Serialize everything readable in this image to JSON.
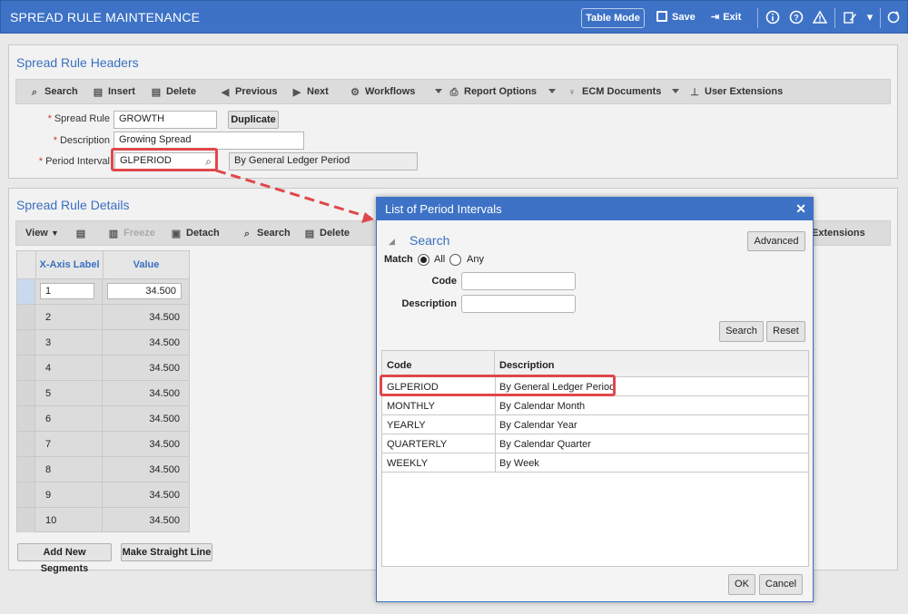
{
  "window": {
    "title": "SPREAD RULE MAINTENANCE",
    "table_mode": "Table Mode",
    "save": "Save",
    "exit": "Exit"
  },
  "header_panel": {
    "title": "Spread Rule Headers",
    "toolbar": [
      "Search",
      "Insert",
      "Delete",
      "Previous",
      "Next",
      "Workflows",
      "Report Options",
      "ECM Documents",
      "User Extensions"
    ],
    "spread_rule_label": "Spread Rule",
    "spread_rule_value": "GROWTH",
    "duplicate": "Duplicate",
    "description_label": "Description",
    "description_value": "Growing Spread",
    "period_interval_label": "Period Interval",
    "period_interval_value": "GLPERIOD",
    "period_interval_desc": "By General Ledger Period"
  },
  "details_panel": {
    "title": "Spread Rule Details",
    "toolbar": [
      "View",
      "Freeze",
      "Detach",
      "Search",
      "Delete",
      "Extensions"
    ],
    "columns": [
      "X-Axis Label",
      "Value"
    ],
    "rows": [
      {
        "label": "1",
        "value": "34.500"
      },
      {
        "label": "2",
        "value": "34.500"
      },
      {
        "label": "3",
        "value": "34.500"
      },
      {
        "label": "4",
        "value": "34.500"
      },
      {
        "label": "5",
        "value": "34.500"
      },
      {
        "label": "6",
        "value": "34.500"
      },
      {
        "label": "7",
        "value": "34.500"
      },
      {
        "label": "8",
        "value": "34.500"
      },
      {
        "label": "9",
        "value": "34.500"
      },
      {
        "label": "10",
        "value": "34.500"
      }
    ],
    "add_segments": "Add New Segments",
    "straight_line": "Make Straight Line"
  },
  "modal": {
    "title": "List of Period Intervals",
    "search_title": "Search",
    "advanced": "Advanced",
    "match_label": "Match",
    "match_all": "All",
    "match_any": "Any",
    "code_label": "Code",
    "description_label": "Description",
    "search_btn": "Search",
    "reset_btn": "Reset",
    "columns": [
      "Code",
      "Description"
    ],
    "rows": [
      {
        "code": "GLPERIOD",
        "desc": "By General Ledger Period"
      },
      {
        "code": "MONTHLY",
        "desc": "By Calendar Month"
      },
      {
        "code": "YEARLY",
        "desc": "By Calendar Year"
      },
      {
        "code": "QUARTERLY",
        "desc": "By Calendar Quarter"
      },
      {
        "code": "WEEKLY",
        "desc": "By Week"
      }
    ],
    "ok": "OK",
    "cancel": "Cancel"
  },
  "colors": {
    "accent": "#3d72c6",
    "highlight": "#e0474c"
  }
}
